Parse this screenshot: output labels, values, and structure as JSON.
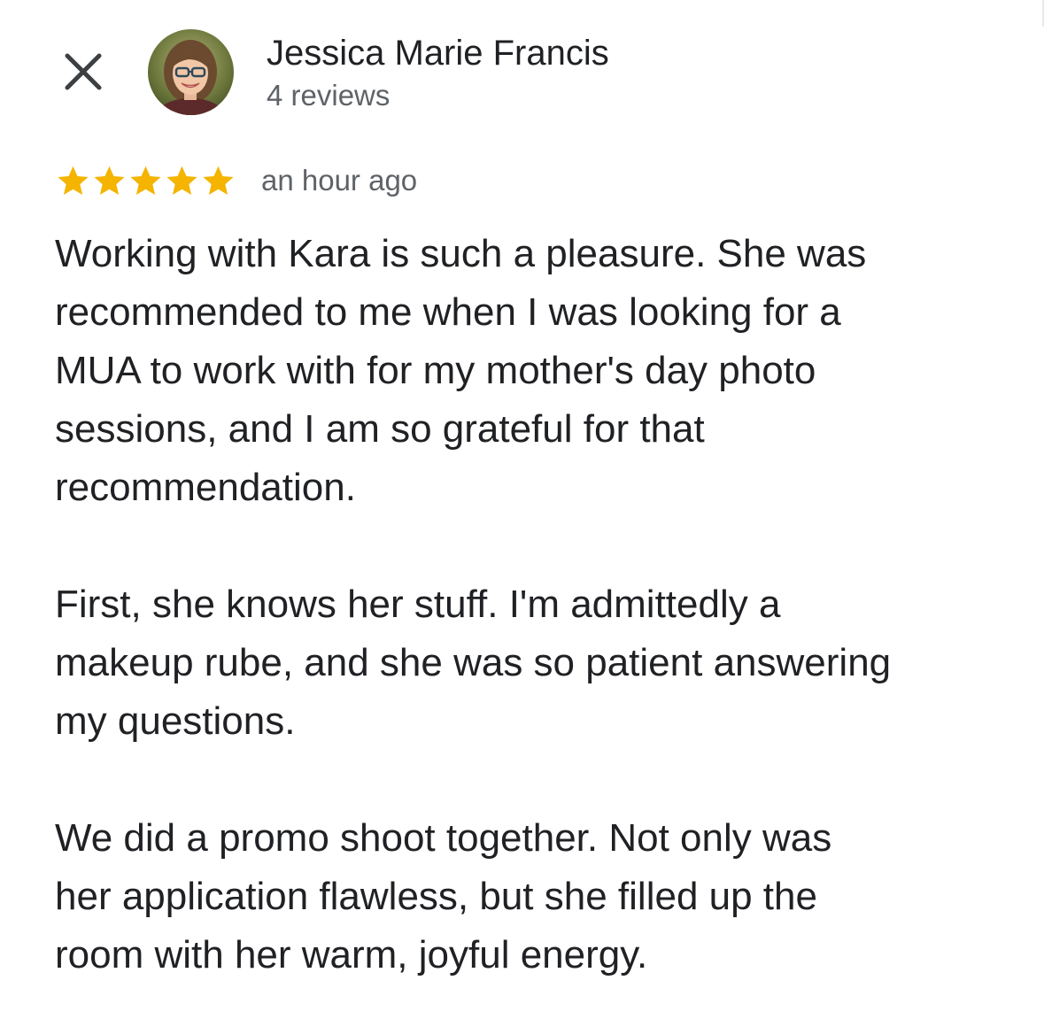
{
  "header": {
    "close_icon": "close-icon",
    "reviewer_name": "Jessica Marie Francis",
    "review_count": "4 reviews"
  },
  "review": {
    "rating": 5,
    "max_rating": 5,
    "star_color": "#F4B400",
    "timestamp": "an hour ago",
    "paragraphs": [
      "Working with Kara is such a pleasure.  She was\nrecommended to me when I was looking for a\nMUA to work with for my mother's day photo\nsessions, and I am so grateful for that\nrecommendation.",
      "First, she knows her stuff.  I'm admittedly a\nmakeup rube, and she was so patient answering\nmy questions.",
      "We did a promo shoot together.  Not only was\nher application flawless, but she filled up the\nroom with her warm, joyful energy."
    ]
  }
}
